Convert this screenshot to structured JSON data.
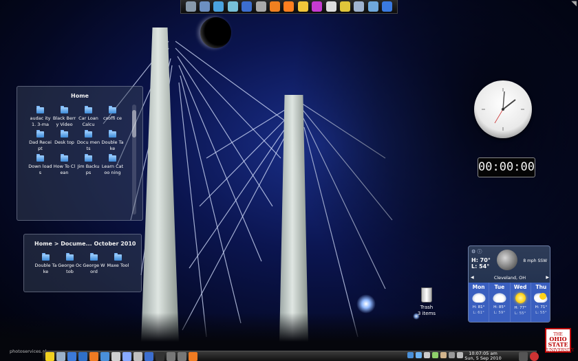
{
  "top_panel": {
    "icons": [
      {
        "name": "app-icon",
        "color": "#8899aa"
      },
      {
        "name": "terminal-icon",
        "color": "#6c8fc0"
      },
      {
        "name": "windows-icon",
        "color": "#4aa3df"
      },
      {
        "name": "cube-icon",
        "color": "#77c0d8"
      },
      {
        "name": "media-m-icon",
        "color": "#3c6ecf"
      },
      {
        "name": "gimp-icon",
        "color": "#a9a9a9"
      },
      {
        "name": "vlc-icon",
        "color": "#f08020"
      },
      {
        "name": "firefox-icon",
        "color": "#ff7f1f"
      },
      {
        "name": "banana-icon",
        "color": "#f3c63a"
      },
      {
        "name": "xmms-icon",
        "color": "#c63bd1"
      },
      {
        "name": "pen-icon",
        "color": "#dddddd"
      },
      {
        "name": "ladder-icon",
        "color": "#e1c63a"
      },
      {
        "name": "calculator-icon",
        "color": "#9fb3cf"
      },
      {
        "name": "package-icon",
        "color": "#6fa8dc"
      },
      {
        "name": "globe-icon",
        "color": "#3a7ae0"
      }
    ]
  },
  "home_view": {
    "title": "Home",
    "items": [
      {
        "label": "audac ity1. 3-ma"
      },
      {
        "label": "Black Berry Video"
      },
      {
        "label": "Car Loan Calcu"
      },
      {
        "label": "cxoffi ce"
      },
      {
        "label": "Dad Receipt"
      },
      {
        "label": "Desk top"
      },
      {
        "label": "Docu ments"
      },
      {
        "label": "Double Take"
      },
      {
        "label": "Down loads"
      },
      {
        "label": "How To Clean"
      },
      {
        "label": "Jim Backu ps"
      },
      {
        "label": "Learn Catoo ning"
      }
    ]
  },
  "docs_view": {
    "title": "Home > Docume... October 2010",
    "items": [
      {
        "label": "Double Take"
      },
      {
        "label": "George Octob"
      },
      {
        "label": "George Word"
      },
      {
        "label": "Maxe Tool"
      }
    ]
  },
  "digital_clock": {
    "time": "00:00:00"
  },
  "trash": {
    "label": "Trash",
    "count": "3 items"
  },
  "weather": {
    "now_high": "H: 70°",
    "now_low": "L: 54°",
    "wind": "8 mph SSW",
    "location": "Cleveland, OH",
    "days": [
      {
        "name": "Mon",
        "icon": "cloud-icon",
        "high": "H: 81°",
        "low": "L: 61°"
      },
      {
        "name": "Tue",
        "icon": "cloud-icon",
        "high": "H: 85°",
        "low": "L: 59°"
      },
      {
        "name": "Wed",
        "icon": "sun-icon",
        "high": "H: 77°",
        "low": "L: 55°"
      },
      {
        "name": "Thu",
        "icon": "sun-cloud-icon",
        "high": "H: 71°",
        "low": "L: 55°"
      }
    ]
  },
  "taskbar": {
    "time": "10:07:05 am",
    "date": "Sun, 5 Sep 2010",
    "icons": [
      {
        "name": "kde-menu-icon",
        "color": "#f0d020"
      },
      {
        "name": "printer-icon",
        "color": "#9ab0c8"
      },
      {
        "name": "mail-icon",
        "color": "#3c7ad8"
      },
      {
        "name": "globe-icon",
        "color": "#2f70c8"
      },
      {
        "name": "firefox-icon",
        "color": "#ef7b22"
      },
      {
        "name": "konqueror-icon",
        "color": "#4a90d9"
      },
      {
        "name": "tools-icon",
        "color": "#d0d0d0"
      },
      {
        "name": "gear-icon",
        "color": "#88aaff"
      },
      {
        "name": "photos-icon",
        "color": "#c0c0c0"
      },
      {
        "name": "media-m-icon",
        "color": "#3c6ecf"
      },
      {
        "name": "terminal-icon",
        "color": "#333333"
      },
      {
        "name": "window-icon",
        "color": "#777777"
      },
      {
        "name": "window-icon",
        "color": "#777777"
      },
      {
        "name": "firefox-icon",
        "color": "#ef7b22"
      }
    ],
    "tray": [
      {
        "name": "network-icon",
        "color": "#4a90d9"
      },
      {
        "name": "music-icon",
        "color": "#6db3f2"
      },
      {
        "name": "volume-icon",
        "color": "#cccccc"
      },
      {
        "name": "battery-icon",
        "color": "#8fd06a"
      },
      {
        "name": "clipboard-icon",
        "color": "#d2b48c"
      },
      {
        "name": "window-icon",
        "color": "#999999"
      },
      {
        "name": "chevron-up-icon",
        "color": "#bbbbbb"
      }
    ]
  },
  "watermark": "photoservices.ol",
  "logo_text": "THE OHIO STATE UNIVERSITY"
}
